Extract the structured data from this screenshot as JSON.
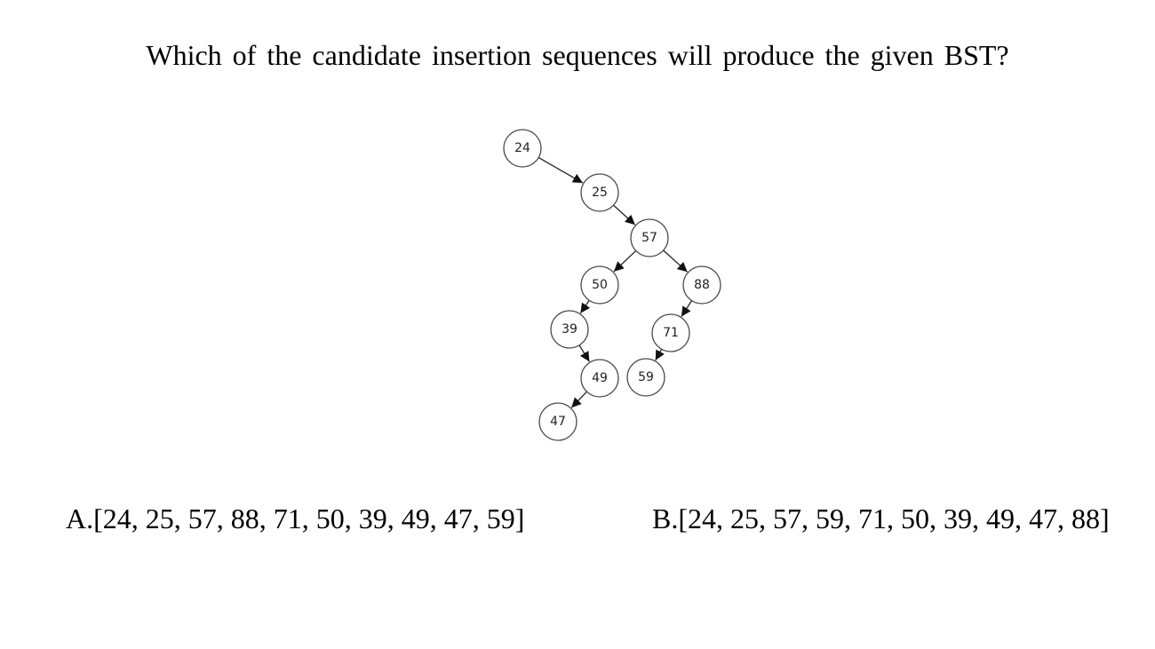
{
  "question": "Which of the candidate insertion sequences will produce the given BST?",
  "tree": {
    "nodes": [
      {
        "id": "24",
        "label": "24"
      },
      {
        "id": "25",
        "label": "25"
      },
      {
        "id": "57",
        "label": "57"
      },
      {
        "id": "50",
        "label": "50"
      },
      {
        "id": "88",
        "label": "88"
      },
      {
        "id": "39",
        "label": "39"
      },
      {
        "id": "71",
        "label": "71"
      },
      {
        "id": "49",
        "label": "49"
      },
      {
        "id": "59",
        "label": "59"
      },
      {
        "id": "47",
        "label": "47"
      }
    ],
    "edges": [
      {
        "from": "24",
        "to": "25"
      },
      {
        "from": "25",
        "to": "57"
      },
      {
        "from": "57",
        "to": "50"
      },
      {
        "from": "57",
        "to": "88"
      },
      {
        "from": "50",
        "to": "39"
      },
      {
        "from": "88",
        "to": "71"
      },
      {
        "from": "39",
        "to": "49"
      },
      {
        "from": "71",
        "to": "59"
      },
      {
        "from": "49",
        "to": "47"
      }
    ]
  },
  "options": {
    "a": "A.[24, 25, 57, 88, 71, 50, 39, 49, 47, 59]",
    "b": "B.[24, 25, 57, 59, 71, 50, 39, 49, 47, 88]"
  }
}
